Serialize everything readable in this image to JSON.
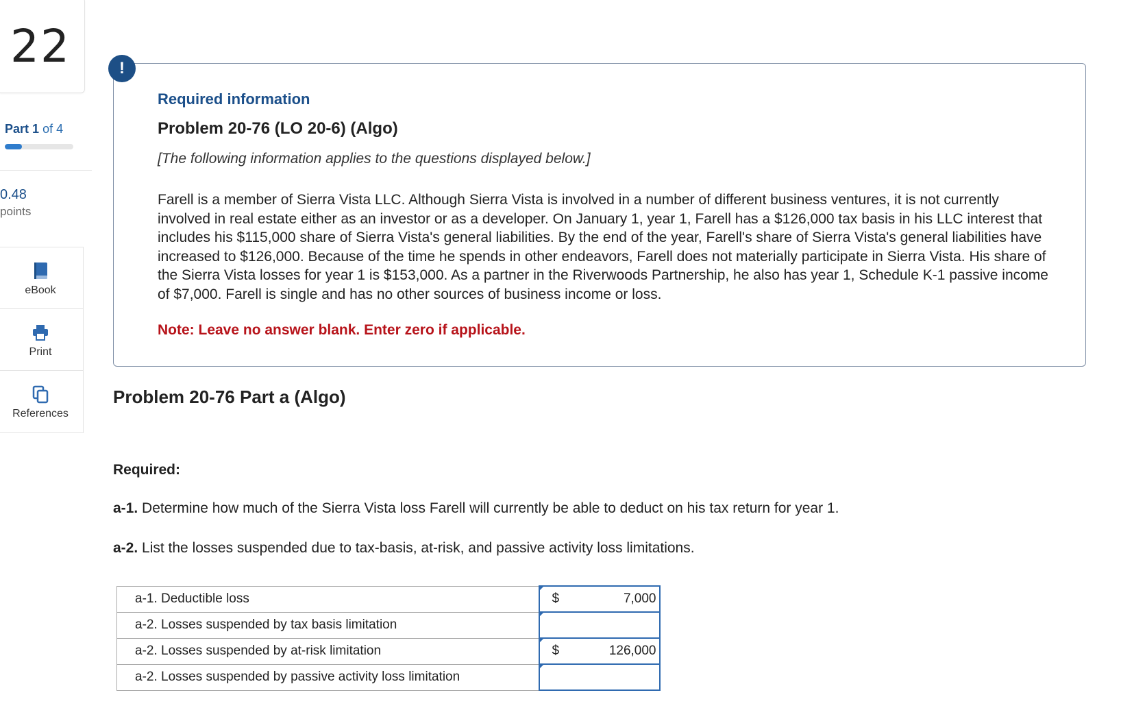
{
  "sidebar": {
    "question_number": "22",
    "part": {
      "word": "Part",
      "current": "1",
      "of": "of 4"
    },
    "progress_fraction": 0.25,
    "points_value": "0.48",
    "points_label": "points",
    "tools": [
      {
        "label": "eBook",
        "icon": "book-icon"
      },
      {
        "label": "Print",
        "icon": "printer-icon"
      },
      {
        "label": "References",
        "icon": "copy-pages-icon"
      }
    ]
  },
  "info": {
    "badge": "!",
    "heading": "Required information",
    "title": "Problem 20-76 (LO 20-6) (Algo)",
    "applies": "[The following information applies to the questions displayed below.]",
    "scenario": "Farell is a member of Sierra Vista LLC. Although Sierra Vista is involved in a number of different business ventures, it is not currently involved in real estate either as an investor or as a developer. On January 1, year 1, Farell has a $126,000 tax basis in his LLC interest that includes his $115,000 share of Sierra Vista's general liabilities. By the end of the year, Farell's share of Sierra Vista's general liabilities have increased to $126,000. Because of the time he spends in other endeavors, Farell does not materially participate in Sierra Vista. His share of the Sierra Vista losses for year 1 is $153,000. As a partner in the Riverwoods Partnership, he also has year 1, Schedule K-1 passive income of $7,000. Farell is single and has no other sources of business income or loss.",
    "note": "Note: Leave no answer blank. Enter zero if applicable."
  },
  "part_title": "Problem 20-76 Part a (Algo)",
  "required_label": "Required:",
  "questions": [
    {
      "num": "a-1.",
      "text": " Determine how much of the Sierra Vista loss Farell will currently be able to deduct on his tax return for year 1."
    },
    {
      "num": "a-2.",
      "text": " List the losses suspended due to tax-basis, at-risk, and passive activity loss limitations."
    }
  ],
  "answers": [
    {
      "label": "a-1. Deductible loss",
      "currency": "$",
      "value": "7,000"
    },
    {
      "label": "a-2. Losses suspended by tax basis limitation",
      "currency": "",
      "value": ""
    },
    {
      "label": "a-2. Losses suspended by at-risk limitation",
      "currency": "$",
      "value": "126,000"
    },
    {
      "label": "a-2. Losses suspended by passive activity loss limitation",
      "currency": "",
      "value": ""
    }
  ]
}
